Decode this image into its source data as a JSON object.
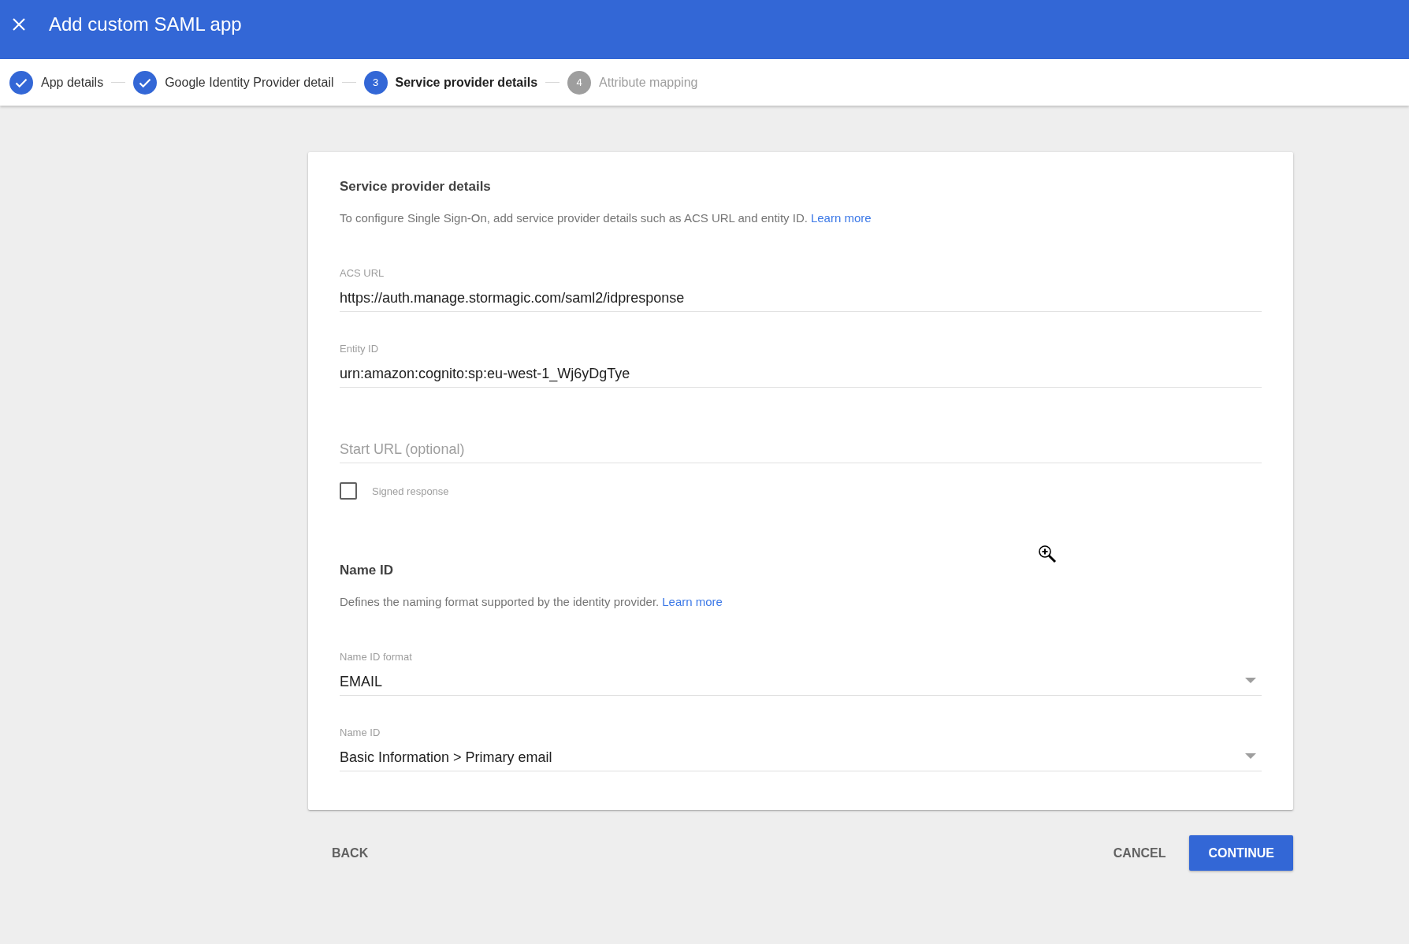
{
  "window": {
    "title": "Add custom SAML app"
  },
  "stepper": {
    "steps": [
      {
        "label": "App details",
        "done": true,
        "selected": false
      },
      {
        "label": "Google Identity Provider detail",
        "done": true,
        "selected": false
      },
      {
        "number": "3",
        "label": "Service provider details",
        "done": false,
        "selected": true
      },
      {
        "number": "4",
        "label": "Attribute mapping",
        "done": false,
        "selected": false
      }
    ]
  },
  "card": {
    "sections": [
      {
        "heading": "Service provider details",
        "description": "To configure Single Sign-On, add service provider details such as ACS URL and entity ID.",
        "link": "Learn more",
        "fields": [
          {
            "kind": "text",
            "label": "ACS URL",
            "value": "https://auth.manage.stormagic.com/saml2/idpresponse"
          },
          {
            "kind": "text",
            "label": "Entity ID",
            "value": "urn:amazon:cognito:sp:eu-west-1_Wj6yDgTye"
          },
          {
            "kind": "text",
            "placeholder": "Start URL (optional)"
          },
          {
            "kind": "checkbox",
            "label": "Signed response",
            "checked": false
          }
        ]
      },
      {
        "heading": "Name ID",
        "description": "Defines the naming format supported by the identity provider.",
        "link": "Learn more",
        "fields": [
          {
            "kind": "select",
            "label": "Name ID format",
            "value": "EMAIL"
          },
          {
            "kind": "select",
            "label": "Name ID",
            "value": "Basic Information > Primary email"
          }
        ]
      }
    ]
  },
  "buttons": [
    {
      "kind": "back",
      "label": "BACK"
    },
    {
      "kind": "cancel",
      "label": "CANCEL"
    },
    {
      "kind": "primary",
      "label": "CONTINUE"
    }
  ]
}
